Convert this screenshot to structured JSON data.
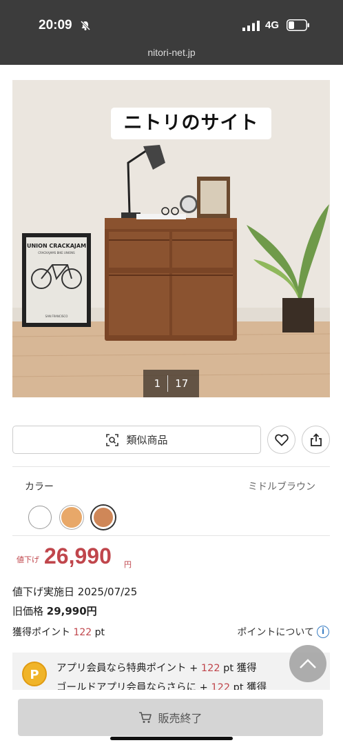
{
  "status_bar": {
    "time": "20:09",
    "network": "4G",
    "url": "nitori-net.jp"
  },
  "gallery": {
    "overlay_title": "ニトリのサイト",
    "current": "1",
    "total": "17",
    "poster_text": "UNION CRACKAJAM",
    "poster_sub": "CRACKAJAMS BIKE UNIONS",
    "poster_footer": "SAN FRANCISCO"
  },
  "actions": {
    "similar_label": "類似商品",
    "favorite_icon": "heart-icon",
    "share_icon": "share-icon"
  },
  "color": {
    "label": "カラー",
    "selected_value": "ミドルブラウン",
    "swatches": [
      "#ffffff",
      "#e8a869",
      "#cf8758"
    ]
  },
  "price": {
    "sale_tag": "値下げ",
    "amount": "26,990",
    "currency": "円"
  },
  "info": {
    "reduced_date_label": "値下げ実施日",
    "reduced_date": "2025/07/25",
    "old_price_label": "旧価格",
    "old_price": "29,990円",
    "points_label": "獲得ポイント",
    "points_value": "122",
    "points_unit": "pt",
    "points_about": "ポイントについて"
  },
  "app_box": {
    "coin": "P",
    "line1_prefix": "アプリ会員なら特典ポイント + ",
    "line1_value": "122",
    "line1_suffix": " pt 獲得",
    "line2_prefix": "ゴールドアプリ会員ならさらに + ",
    "line2_value": "122",
    "line2_suffix": " pt 獲得"
  },
  "bottom": {
    "soldout_label": "販売終了"
  },
  "colors": {
    "accent_red": "#c0464c",
    "status_bar_bg": "#3c3c3c"
  }
}
